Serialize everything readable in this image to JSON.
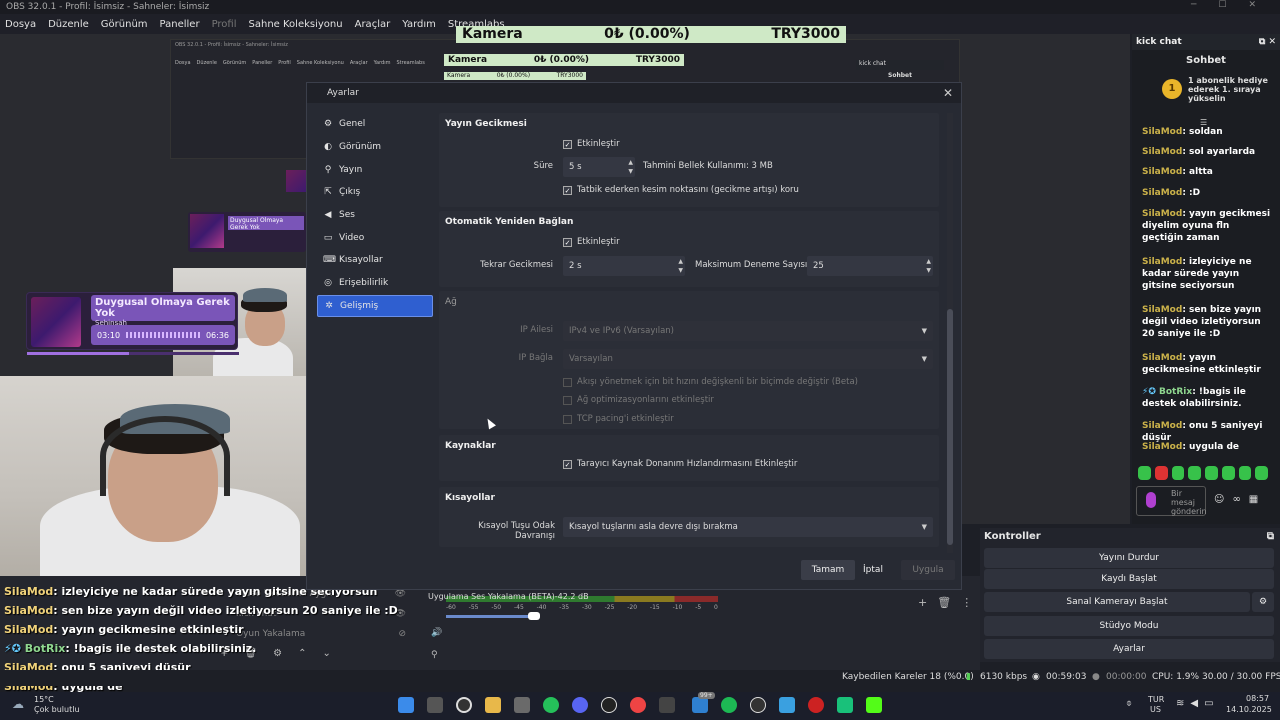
{
  "window": {
    "title": "OBS 32.0.1 - Profil: İsimsiz - Sahneler: İsimsiz",
    "menu": [
      "Dosya",
      "Düzenle",
      "Görünüm",
      "Paneller",
      "Profil",
      "Sahne Koleksiyonu",
      "Araçlar",
      "Yardım",
      "Streamlabs"
    ]
  },
  "stats_overlay": {
    "label": "Kamera",
    "amount": "0₺ (0.00%)",
    "goal": "TRY3000"
  },
  "now_playing": {
    "title": "Duygusal Olmaya Gerek Yok",
    "artist": "Şehinşah",
    "elapsed": "03:10",
    "duration": "06:36",
    "progress": 0.48
  },
  "overlay_chat": [
    {
      "user": "SilaMod",
      "text": "izleyiciye ne kadar sürede yayın gitsine seciyorsun"
    },
    {
      "user": "SilaMod",
      "text": "sen bize yayın değil video izletiyorsun 20 saniye ile :D"
    },
    {
      "user": "SilaMod",
      "text": "yayın gecikmesine etkinleştir"
    },
    {
      "user": "BotRix",
      "text": "!bagis ile destek olabilirsiniz."
    },
    {
      "user": "SilaMod",
      "text": "onu 5 saniyeyi düşür"
    },
    {
      "user": "SilaMod",
      "text": "uygula de"
    }
  ],
  "sources": [
    {
      "label": "Video Yakalama Aygıtı"
    },
    {
      "label": "kick chat"
    },
    {
      "label": "Oyun Yakalama"
    }
  ],
  "mixer": {
    "name": "Uygulama Ses Yakalama (BETA)",
    "db": "-42.2 dB",
    "scale": [
      "-60",
      "-55",
      "-50",
      "-45",
      "-40",
      "-35",
      "-30",
      "-25",
      "-20",
      "-15",
      "-10",
      "-5",
      "0"
    ]
  },
  "controls": {
    "header": "Kontroller",
    "buttons": [
      "Yayını Durdur",
      "Kaydı Başlat",
      "Sanal Kamerayı Başlat",
      "Stüdyo Modu",
      "Ayarlar"
    ]
  },
  "statusbar": {
    "dropped": "Kaybedilen Kareler 18 (%0.0)",
    "bitrate": "6130 kbps",
    "stream_time": "00:59:03",
    "rec_time": "00:00:00",
    "cpu": "CPU: 1.9%",
    "fps": "30.00 / 30.00 FPS"
  },
  "kick_chat": {
    "dock_title": "kick chat",
    "tab": "Sohbet",
    "gift_text": "1 abonelik hediye ederek 1. sıraya yükselin",
    "gift_rank": "1",
    "messages": [
      {
        "user": "SilaMod",
        "text": "soldan"
      },
      {
        "user": "SilaMod",
        "text": "sol ayarlarda"
      },
      {
        "user": "SilaMod",
        "text": "altta"
      },
      {
        "user": "SilaMod",
        "text": ":D"
      },
      {
        "user": "SilaMod",
        "text": "yayın gecikmesi diyelim oyuna fln geçtiğin zaman"
      },
      {
        "user": "SilaMod",
        "text": "izleyiciye ne kadar sürede yayın gitsine seciyorsun"
      },
      {
        "user": "SilaMod",
        "text": "sen bize yayın değil video izletiyorsun 20 saniye ile :D"
      },
      {
        "user": "SilaMod",
        "text": "yayın gecikmesine etkinleştir"
      },
      {
        "user": "BotRix",
        "text": "!bagis ile destek olabilirsiniz."
      },
      {
        "user": "SilaMod",
        "text": "onu 5 saniyeyi düşür"
      },
      {
        "user": "SilaMod",
        "text": "uygula de"
      }
    ],
    "input_placeholder": "Bir mesaj gönderin"
  },
  "taskbar": {
    "weather_temp": "15°C",
    "weather_desc": "Çok bulutlu",
    "lang": "TUR",
    "region": "US",
    "time": "08:57",
    "date": "14.10.2025",
    "badge": "99+"
  },
  "dialog": {
    "title": "Ayarlar",
    "nav": [
      {
        "label": "Genel",
        "icon": "gear-icon"
      },
      {
        "label": "Görünüm",
        "icon": "palette-icon"
      },
      {
        "label": "Yayın",
        "icon": "broadcast-icon"
      },
      {
        "label": "Çıkış",
        "icon": "output-icon"
      },
      {
        "label": "Ses",
        "icon": "speaker-icon"
      },
      {
        "label": "Video",
        "icon": "monitor-icon"
      },
      {
        "label": "Kısayollar",
        "icon": "keyboard-icon"
      },
      {
        "label": "Erişebilirlik",
        "icon": "accessibility-icon"
      },
      {
        "label": "Gelişmiş",
        "icon": "tools-icon"
      }
    ],
    "active_nav": "Gelişmiş",
    "delay": {
      "title": "Yayın Gecikmesi",
      "enable": "Etkinleştir",
      "duration_label": "Süre",
      "duration_value": "5 s",
      "memory": "Tahmini Bellek Kullanımı: 3 MB",
      "preserve": "Tatbik ederken kesim noktasını (gecikme artışı) koru"
    },
    "reconnect": {
      "title": "Otomatik Yeniden Bağlan",
      "enable": "Etkinleştir",
      "retry_label": "Tekrar Gecikmesi",
      "retry_value": "2 s",
      "max_label": "Maksimum Deneme Sayısı",
      "max_value": "25"
    },
    "network": {
      "title": "Ağ",
      "ip_family_label": "IP Ailesi",
      "ip_family_value": "IPv4 ve IPv6 (Varsayılan)",
      "bind_ip_label": "IP Bağla",
      "bind_ip_value": "Varsayılan",
      "dynamic_bitrate": "Akışı yönetmek için bit hızını değişkenli bir biçimde değiştir (Beta)",
      "optimizations": "Ağ optimizasyonlarını etkinleştir",
      "tcp_pacing": "TCP pacing'i etkinleştir"
    },
    "sources": {
      "title": "Kaynaklar",
      "hw_accel": "Tarayıcı Kaynak Donanım Hızlandırmasını Etkinleştir"
    },
    "hotkeys": {
      "title": "Kısayollar",
      "focus_label": "Kısayol Tuşu Odak Davranışı",
      "focus_value": "Kısayol tuşlarını asla devre dışı bırakma"
    },
    "buttons": {
      "ok": "Tamam",
      "cancel": "İptal",
      "apply": "Uygula"
    }
  }
}
